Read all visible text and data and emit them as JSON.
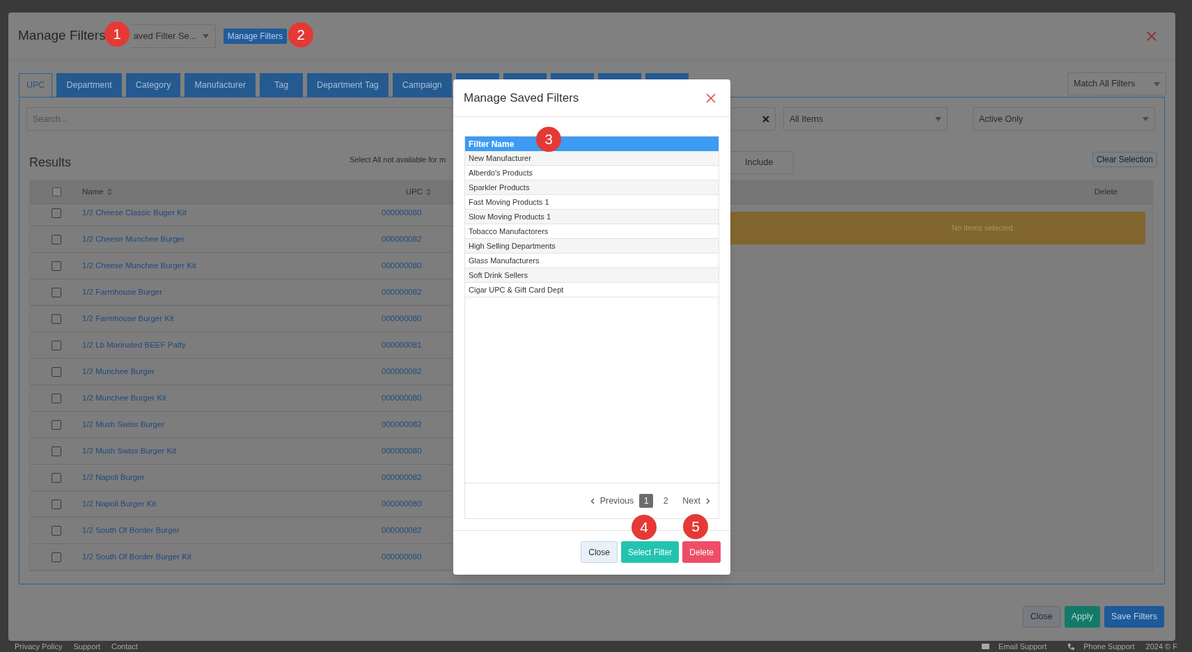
{
  "dialog": {
    "title": "Manage Filters",
    "saved_filter_select": {
      "value": "aved Filter Se..."
    },
    "manage_button": "Manage Filters"
  },
  "tabs": [
    {
      "label": "UPC",
      "selected": true
    },
    {
      "label": "Department",
      "selected": false
    },
    {
      "label": "Category",
      "selected": false
    },
    {
      "label": "Manufacturer",
      "selected": false
    },
    {
      "label": "Tag",
      "selected": false
    },
    {
      "label": "Department Tag",
      "selected": false
    },
    {
      "label": "Campaign",
      "selected": false
    },
    {
      "selected": false
    },
    {
      "selected": false
    },
    {
      "selected": false
    },
    {
      "selected": false
    },
    {
      "selected": false
    }
  ],
  "match_select": {
    "value": "Match All Filters"
  },
  "search": {
    "placeholder": "Search..."
  },
  "items_select": {
    "value": "All Items"
  },
  "status_select": {
    "value": "Active Only"
  },
  "results": {
    "title": "Results",
    "notice": "Select All not available for m",
    "include_button": "Include",
    "clear_button": "Clear Selection",
    "select_all": {
      "checked": false
    },
    "columns": [
      "Name",
      "UPC"
    ],
    "rows": [
      {
        "name": "1/2 Cheese Classic Buger Kit",
        "upc": "000000080",
        "checked": false
      },
      {
        "name": "1/2 Cheese Munchee Burger",
        "upc": "000000082",
        "checked": false
      },
      {
        "name": "1/2 Cheese Munchee Burger Kit",
        "upc": "000000080",
        "checked": false
      },
      {
        "name": "1/2 Farmhouse Burger",
        "upc": "000000082",
        "checked": false
      },
      {
        "name": "1/2 Farmhouse Burger Kit",
        "upc": "000000080",
        "checked": false
      },
      {
        "name": "1/2 Lb Marinated BEEF Patty",
        "upc": "000000081",
        "checked": false
      },
      {
        "name": "1/2 Munchee Burger",
        "upc": "000000082",
        "checked": false
      },
      {
        "name": "1/2 Munchee Burger Kit",
        "upc": "000000080",
        "checked": false
      },
      {
        "name": "1/2 Mush Swiss Burger",
        "upc": "000000082",
        "checked": false
      },
      {
        "name": "1/2 Mush Swiss Burger Kit",
        "upc": "000000080",
        "checked": false
      },
      {
        "name": "1/2 Napoli Burger",
        "upc": "000000082",
        "checked": false
      },
      {
        "name": "1/2 Napoli Burger Kit",
        "upc": "000000080",
        "checked": false
      },
      {
        "name": "1/2 South Of Border Burger",
        "upc": "000000082",
        "checked": false
      },
      {
        "name": "1/2 South Of Border Burger Kit",
        "upc": "000000080",
        "checked": false
      }
    ]
  },
  "selection": {
    "column": "Delete",
    "empty_message": "No items selected."
  },
  "footer_buttons": [
    {
      "label": "Close",
      "kind": "secondary"
    },
    {
      "label": "Apply",
      "kind": "success"
    },
    {
      "label": "Save Filters",
      "kind": "primary"
    }
  ],
  "page_footer": {
    "links": [
      "Privacy Policy",
      "Support",
      "Contact"
    ],
    "email": "Email Support",
    "phone": "Phone Support",
    "copyright": "2024 © F"
  },
  "saved_filters_modal": {
    "title": "Manage Saved Filters",
    "column": "Filter Name",
    "filters": [
      "New Manufacturer",
      "Alberdo's Products",
      "Sparkler Products",
      "Fast Moving Products 1",
      "Slow Moving Products 1",
      "Tobacco Manufactorers",
      "High Selling Departments",
      "Glass Manufacturers",
      "Soft Drink Sellers",
      "Cigar UPC & Gift Card Dept"
    ],
    "pagination": {
      "previous": "Previous",
      "next": "Next",
      "pages": [
        {
          "label": "1",
          "selected": true
        },
        {
          "label": "2",
          "selected": false
        }
      ]
    },
    "buttons": [
      {
        "label": "Close",
        "kind": "secondary"
      },
      {
        "label": "Select Filter",
        "kind": "success"
      },
      {
        "label": "Delete",
        "kind": "danger"
      }
    ]
  },
  "annotations": [
    "1",
    "2",
    "3",
    "4",
    "5"
  ]
}
